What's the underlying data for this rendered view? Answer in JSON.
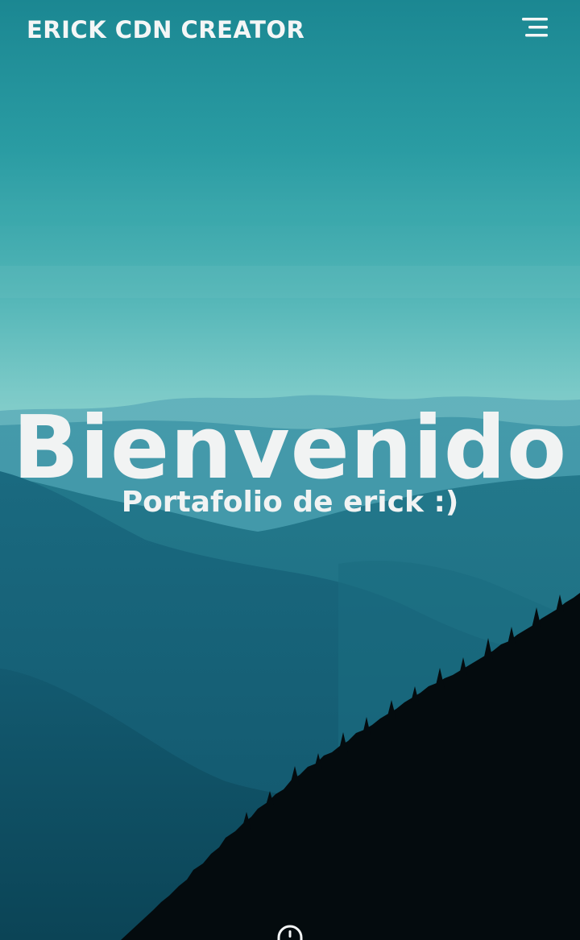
{
  "header": {
    "brand": "ERICK CDN CREATOR",
    "menu_icon": "menu-icon"
  },
  "hero": {
    "title": "Bienvenido",
    "subtitle": "Portafolio de erick :)",
    "background": "mountain-landscape-photo",
    "scroll_icon": "mouse-scroll-icon"
  },
  "colors": {
    "sky_top": "#1e8f99",
    "sky_mid": "#5fbfc0",
    "mountain_far": "#3f9aa9",
    "mountain_mid": "#1f7a8e",
    "mountain_dark": "#0e4d5f",
    "forest": "#030a0d",
    "text": "#f1f3f3"
  }
}
